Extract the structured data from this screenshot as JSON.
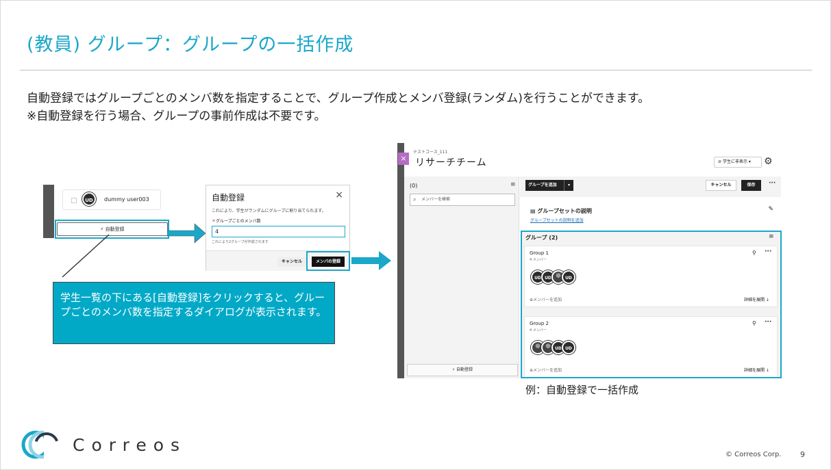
{
  "title": "(教員) グループ：グループの一括作成",
  "body_line1": "自動登録ではグループごとのメンバ数を指定することで、グループ作成とメンバ登録(ランダム)を行うことができます。",
  "body_line2": "※自動登録を行う場合、グループの事前作成は不要です。",
  "left_shot": {
    "avatar_initials": "UD",
    "user_name": "dummy user003",
    "auto_button": "自動登録"
  },
  "dialog": {
    "title": "自動登録",
    "close": "×",
    "description": "これにより、学生がランダムにグループに割り当てられます。",
    "required_mark": "＊",
    "field_label": "グループごとのメンバ数",
    "field_value": "4",
    "hint": "これにより2グループが作成されます",
    "cancel": "キャンセル",
    "submit": "メンバの登録"
  },
  "callout": {
    "text": "学生一覧の下にある[自動登録]をクリックすると、グループごとのメンバ数を指定するダイアログが表示されます。"
  },
  "right_shot": {
    "close_icon": "×",
    "course": "テストコース_111",
    "team": "リサーチチーム",
    "visibility": "学生に非表示",
    "left_count": "(0)",
    "search_placeholder": "メンバーを検索",
    "left_auto_button": "自動登録",
    "add_group": "グループを追加",
    "cancel": "キャンセル",
    "save": "保存",
    "groupset_title": "グループセットの説明",
    "groupset_link": "グループセットの説明を追加",
    "groups_header": "グループ (2)",
    "groups": [
      {
        "name": "Group 1",
        "members": "4 メンバー",
        "avatars": [
          "UD",
          "UD",
          "",
          "UD"
        ],
        "add": "メンバーを追加",
        "expand": "詳細を展開"
      },
      {
        "name": "Group 2",
        "members": "4 メンバー",
        "avatars": [
          "",
          "",
          "UD",
          "UD"
        ],
        "add": "メンバーを追加",
        "expand": "詳細を展開"
      }
    ]
  },
  "caption": "例：自動登録で一括作成",
  "footer": {
    "logo_text": "Correos",
    "copyright": "© Correos Corp.",
    "page": "9"
  },
  "colors": {
    "accent": "#1aa7c9",
    "callout": "#02a9c7"
  }
}
